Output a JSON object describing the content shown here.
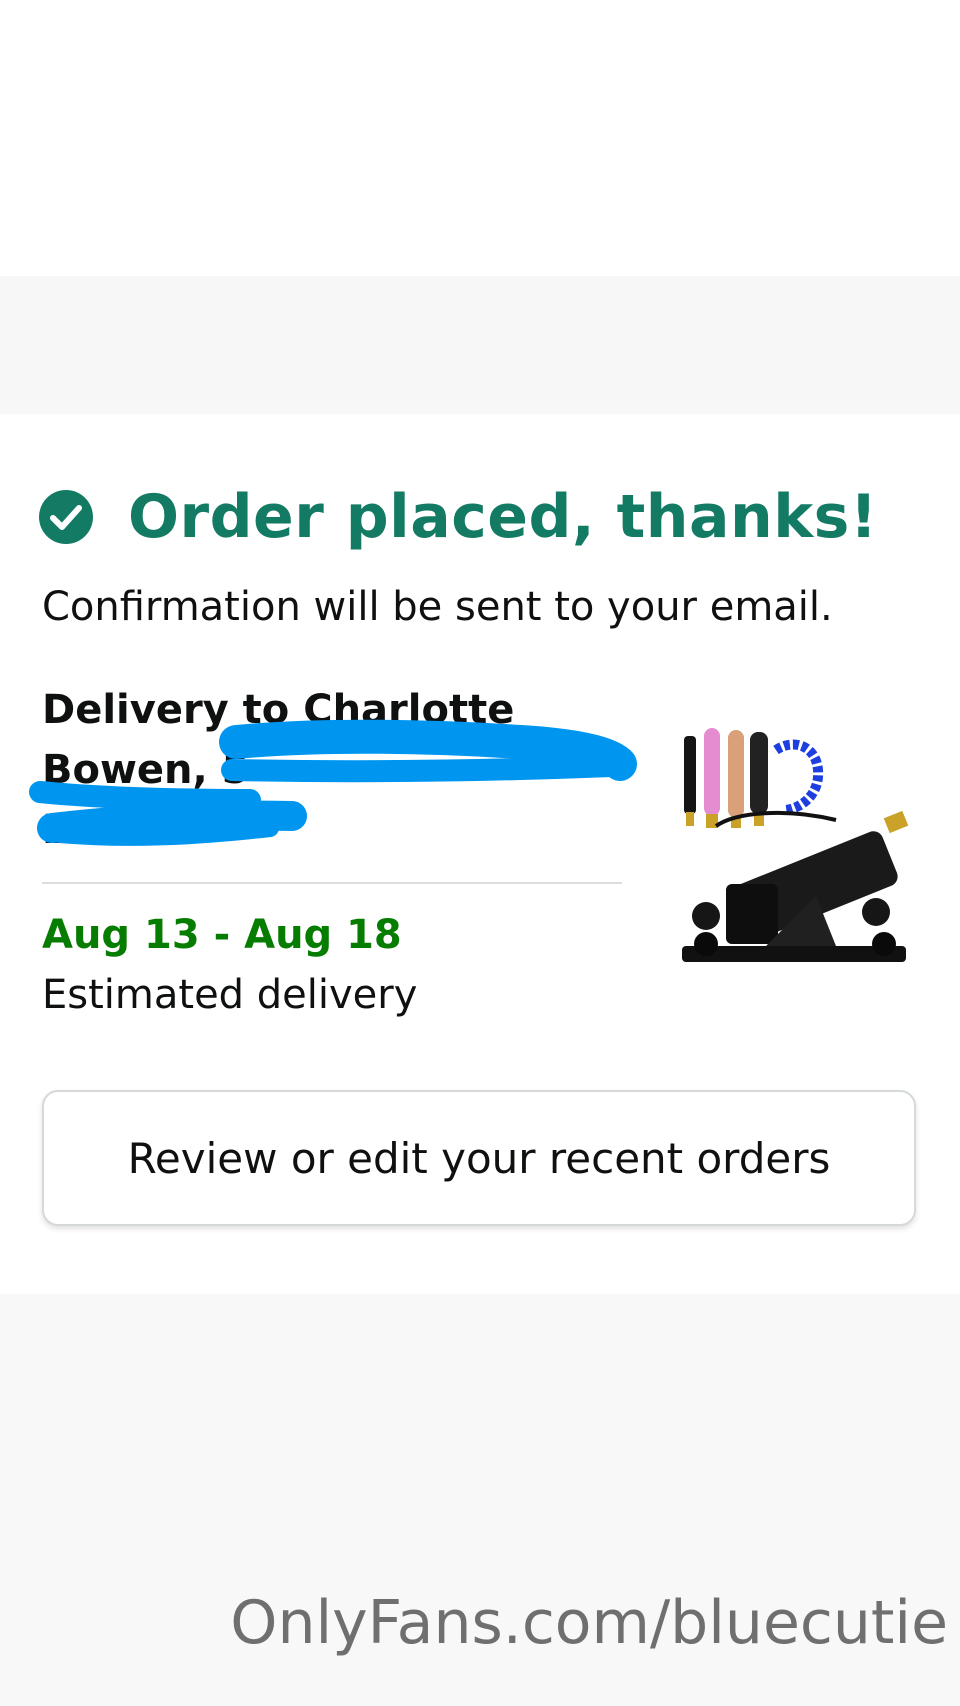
{
  "confirmation": {
    "heading": "Order placed, thanks!",
    "message": "Confirmation will be sent to your email."
  },
  "delivery": {
    "line1": "Delivery to Charlotte",
    "line2": "Bowen, 5",
    "line3": "E                  DE",
    "date_range": "Aug 13 - Aug 18",
    "estimated_label": "Estimated delivery"
  },
  "product": {
    "image_icon": "product-image"
  },
  "actions": {
    "review_orders": "Review or edit your recent orders"
  },
  "watermark": "OnlyFans.com/bluecutie",
  "colors": {
    "heading_green": "#137a63",
    "date_green": "#067d00",
    "redaction_blue": "#0096f0"
  }
}
